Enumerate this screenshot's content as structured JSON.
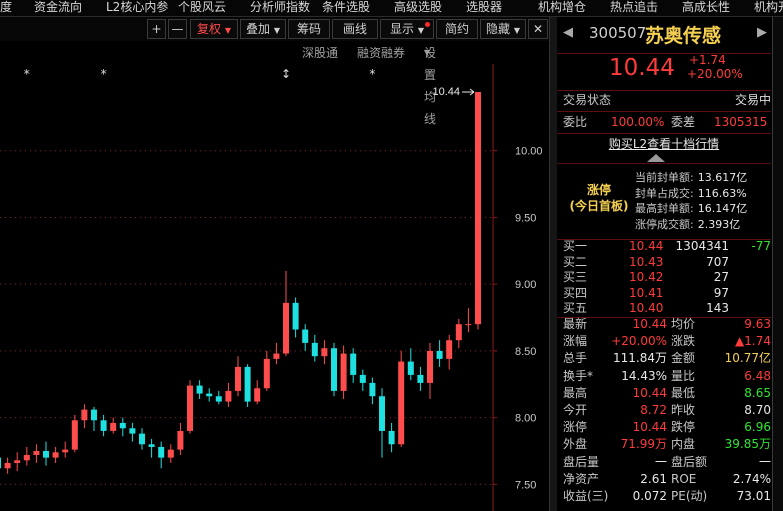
{
  "menu": {
    "items": [
      "度",
      "资金流向",
      "L2核心内参",
      "个股风云",
      "分析师指数",
      "条件选股",
      "高级选股",
      "选股器",
      "机构增仓",
      "热点追击",
      "高成长性",
      "机构开"
    ]
  },
  "toolbar": {
    "plus": "+",
    "minus": "—",
    "fuquan": "复权",
    "diejia": "叠加",
    "choumai": "筹码",
    "huaxian": "画线",
    "xianshi": "显示",
    "jianyue": "简约",
    "yincang": "隐藏"
  },
  "subbar": {
    "shengu": "深股通",
    "rongzi": "融资融券",
    "junxian": "设置均线"
  },
  "chart_data": {
    "type": "candlestick",
    "price_labels": [
      "10.00",
      "9.50",
      "9.00",
      "8.50",
      "8.00",
      "7.50"
    ],
    "price_ticks": [
      10.0,
      9.5,
      9.0,
      8.5,
      8.0,
      7.5
    ],
    "ylim": [
      7.3,
      10.65
    ],
    "last_price_label": "10.44",
    "up_color": "#ff4d4d",
    "down_color": "#1fe0e0",
    "markers": [
      {
        "i": 3,
        "glyph": "*"
      },
      {
        "i": 11,
        "glyph": "*"
      },
      {
        "i": 30,
        "glyph": "↕"
      },
      {
        "i": 39,
        "glyph": "*"
      }
    ],
    "candles": [
      [
        7.7,
        7.62,
        7.78,
        7.55
      ],
      [
        7.62,
        7.66,
        7.7,
        7.58
      ],
      [
        7.66,
        7.68,
        7.74,
        7.6
      ],
      [
        7.68,
        7.72,
        7.78,
        7.64
      ],
      [
        7.72,
        7.75,
        7.8,
        7.66
      ],
      [
        7.75,
        7.7,
        7.82,
        7.64
      ],
      [
        7.7,
        7.74,
        7.78,
        7.66
      ],
      [
        7.74,
        7.76,
        7.82,
        7.7
      ],
      [
        7.76,
        7.98,
        8.02,
        7.74
      ],
      [
        7.98,
        8.06,
        8.1,
        7.92
      ],
      [
        8.06,
        7.98,
        8.08,
        7.9
      ],
      [
        7.98,
        7.9,
        8.02,
        7.86
      ],
      [
        7.9,
        7.96,
        8.0,
        7.88
      ],
      [
        7.96,
        7.92,
        8.0,
        7.86
      ],
      [
        7.92,
        7.88,
        7.96,
        7.82
      ],
      [
        7.88,
        7.8,
        7.92,
        7.76
      ],
      [
        7.8,
        7.78,
        7.84,
        7.7
      ],
      [
        7.78,
        7.7,
        7.82,
        7.62
      ],
      [
        7.7,
        7.76,
        7.8,
        7.66
      ],
      [
        7.76,
        7.9,
        7.96,
        7.72
      ],
      [
        7.9,
        8.24,
        8.28,
        7.88
      ],
      [
        8.24,
        8.18,
        8.28,
        8.14
      ],
      [
        8.18,
        8.16,
        8.22,
        8.12
      ],
      [
        8.16,
        8.12,
        8.2,
        8.1
      ],
      [
        8.12,
        8.2,
        8.26,
        8.08
      ],
      [
        8.2,
        8.38,
        8.46,
        8.16
      ],
      [
        8.38,
        8.12,
        8.4,
        8.08
      ],
      [
        8.12,
        8.22,
        8.28,
        8.1
      ],
      [
        8.22,
        8.44,
        8.5,
        8.2
      ],
      [
        8.44,
        8.48,
        8.56,
        8.4
      ],
      [
        8.48,
        8.86,
        9.1,
        8.46
      ],
      [
        8.86,
        8.66,
        8.9,
        8.6
      ],
      [
        8.66,
        8.56,
        8.7,
        8.5
      ],
      [
        8.56,
        8.46,
        8.62,
        8.42
      ],
      [
        8.46,
        8.52,
        8.58,
        8.4
      ],
      [
        8.52,
        8.2,
        8.56,
        8.16
      ],
      [
        8.2,
        8.48,
        8.54,
        8.14
      ],
      [
        8.48,
        8.32,
        8.52,
        8.26
      ],
      [
        8.32,
        8.26,
        8.36,
        8.2
      ],
      [
        8.26,
        8.16,
        8.3,
        8.1
      ],
      [
        8.16,
        7.9,
        8.22,
        7.7
      ],
      [
        7.9,
        7.8,
        7.96,
        7.74
      ],
      [
        7.8,
        8.42,
        8.5,
        7.78
      ],
      [
        8.42,
        8.32,
        8.52,
        8.28
      ],
      [
        8.32,
        8.26,
        8.38,
        8.2
      ],
      [
        8.26,
        8.5,
        8.56,
        8.14
      ],
      [
        8.5,
        8.44,
        8.58,
        8.38
      ],
      [
        8.44,
        8.58,
        8.62,
        8.36
      ],
      [
        8.58,
        8.7,
        8.74,
        8.52
      ],
      [
        8.7,
        8.7,
        8.82,
        8.64
      ],
      [
        8.7,
        10.44,
        10.44,
        8.66
      ]
    ]
  },
  "stock": {
    "code": "300507",
    "name": "苏奥传感",
    "price": "10.44",
    "change": "+1.74",
    "pct": "+20.00%"
  },
  "status": {
    "label": "交易状态",
    "value": "交易中"
  },
  "weibi": {
    "label": "委比",
    "value": "100.00%",
    "label2": "委差",
    "value2": "1305315"
  },
  "l2link": "购买L2查看十档行情",
  "limit": {
    "badge1": "涨停",
    "badge2": "(今日首板)",
    "lines": [
      {
        "label": "当前封单额:",
        "value": "13.617亿"
      },
      {
        "label": "封单占成交:",
        "value": "116.63%"
      },
      {
        "label": "最高封单额:",
        "value": "16.147亿"
      },
      {
        "label": "涨停成交额:",
        "value": "2.393亿"
      }
    ]
  },
  "bids": [
    {
      "label": "买一",
      "price": "10.44",
      "vol": "1304341",
      "chg": "-77"
    },
    {
      "label": "买二",
      "price": "10.43",
      "vol": "707",
      "chg": ""
    },
    {
      "label": "买三",
      "price": "10.42",
      "vol": "27",
      "chg": ""
    },
    {
      "label": "买四",
      "price": "10.41",
      "vol": "97",
      "chg": ""
    },
    {
      "label": "买五",
      "price": "10.40",
      "vol": "143",
      "chg": ""
    }
  ],
  "quote": [
    {
      "l1": "最新",
      "v1": "10.44",
      "c1": "red",
      "l2": "均价",
      "v2": "9.63",
      "c2": "red"
    },
    {
      "l1": "涨幅",
      "v1": "+20.00%",
      "c1": "red",
      "l2": "涨跌",
      "v2": "▲1.74",
      "c2": "red"
    },
    {
      "l1": "总手",
      "v1": "111.84万",
      "c1": "white",
      "l2": "金额",
      "v2": "10.77亿",
      "c2": "gold"
    },
    {
      "l1": "换手*",
      "v1": "14.43%",
      "c1": "white",
      "l2": "量比",
      "v2": "6.48",
      "c2": "red"
    },
    {
      "l1": "最高",
      "v1": "10.44",
      "c1": "red",
      "l2": "最低",
      "v2": "8.65",
      "c2": "green"
    },
    {
      "l1": "今开",
      "v1": "8.72",
      "c1": "red",
      "l2": "昨收",
      "v2": "8.70",
      "c2": "white"
    },
    {
      "l1": "涨停",
      "v1": "10.44",
      "c1": "red",
      "l2": "跌停",
      "v2": "6.96",
      "c2": "green"
    },
    {
      "l1": "外盘",
      "v1": "71.99万",
      "c1": "red",
      "l2": "内盘",
      "v2": "39.85万",
      "c2": "green"
    },
    {
      "l1": "盘后量",
      "v1": "一",
      "c1": "white",
      "l2": "盘后额",
      "v2": "一",
      "c2": "white"
    },
    {
      "l1": "净资产",
      "v1": "2.61",
      "c1": "white",
      "l2": "ROE",
      "v2": "2.74%",
      "c2": "white"
    },
    {
      "l1": "收益(三)",
      "v1": "0.072",
      "c1": "white",
      "l2": "PE(动)",
      "v2": "73.01",
      "c2": "white"
    }
  ]
}
